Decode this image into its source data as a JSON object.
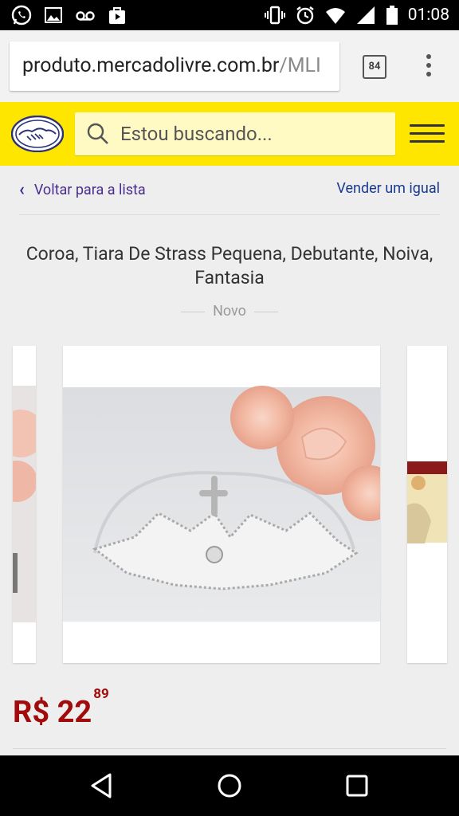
{
  "status_bar": {
    "time": "01:08",
    "icons": [
      "whatsapp-icon",
      "image-icon",
      "voicemail-icon",
      "play-store-icon",
      "vibrate-icon",
      "alarm-icon",
      "wifi-icon",
      "signal-icon",
      "battery-icon"
    ]
  },
  "browser": {
    "url_main": "produto.mercadolivre.com.br",
    "url_rest": "/MLI",
    "tab_count": "84"
  },
  "header": {
    "search_placeholder": "Estou buscando...",
    "brand_color": "#fee600"
  },
  "nav": {
    "back_label": "Voltar para a lista",
    "sell_label": "Vender um igual"
  },
  "product": {
    "title": "Coroa, Tiara De Strass Pequena, Debutante, Noiva, Fantasia",
    "condition": "Novo",
    "price_currency_int": "R$ 22",
    "price_cents": "89",
    "price_color": "#a10b0b"
  }
}
